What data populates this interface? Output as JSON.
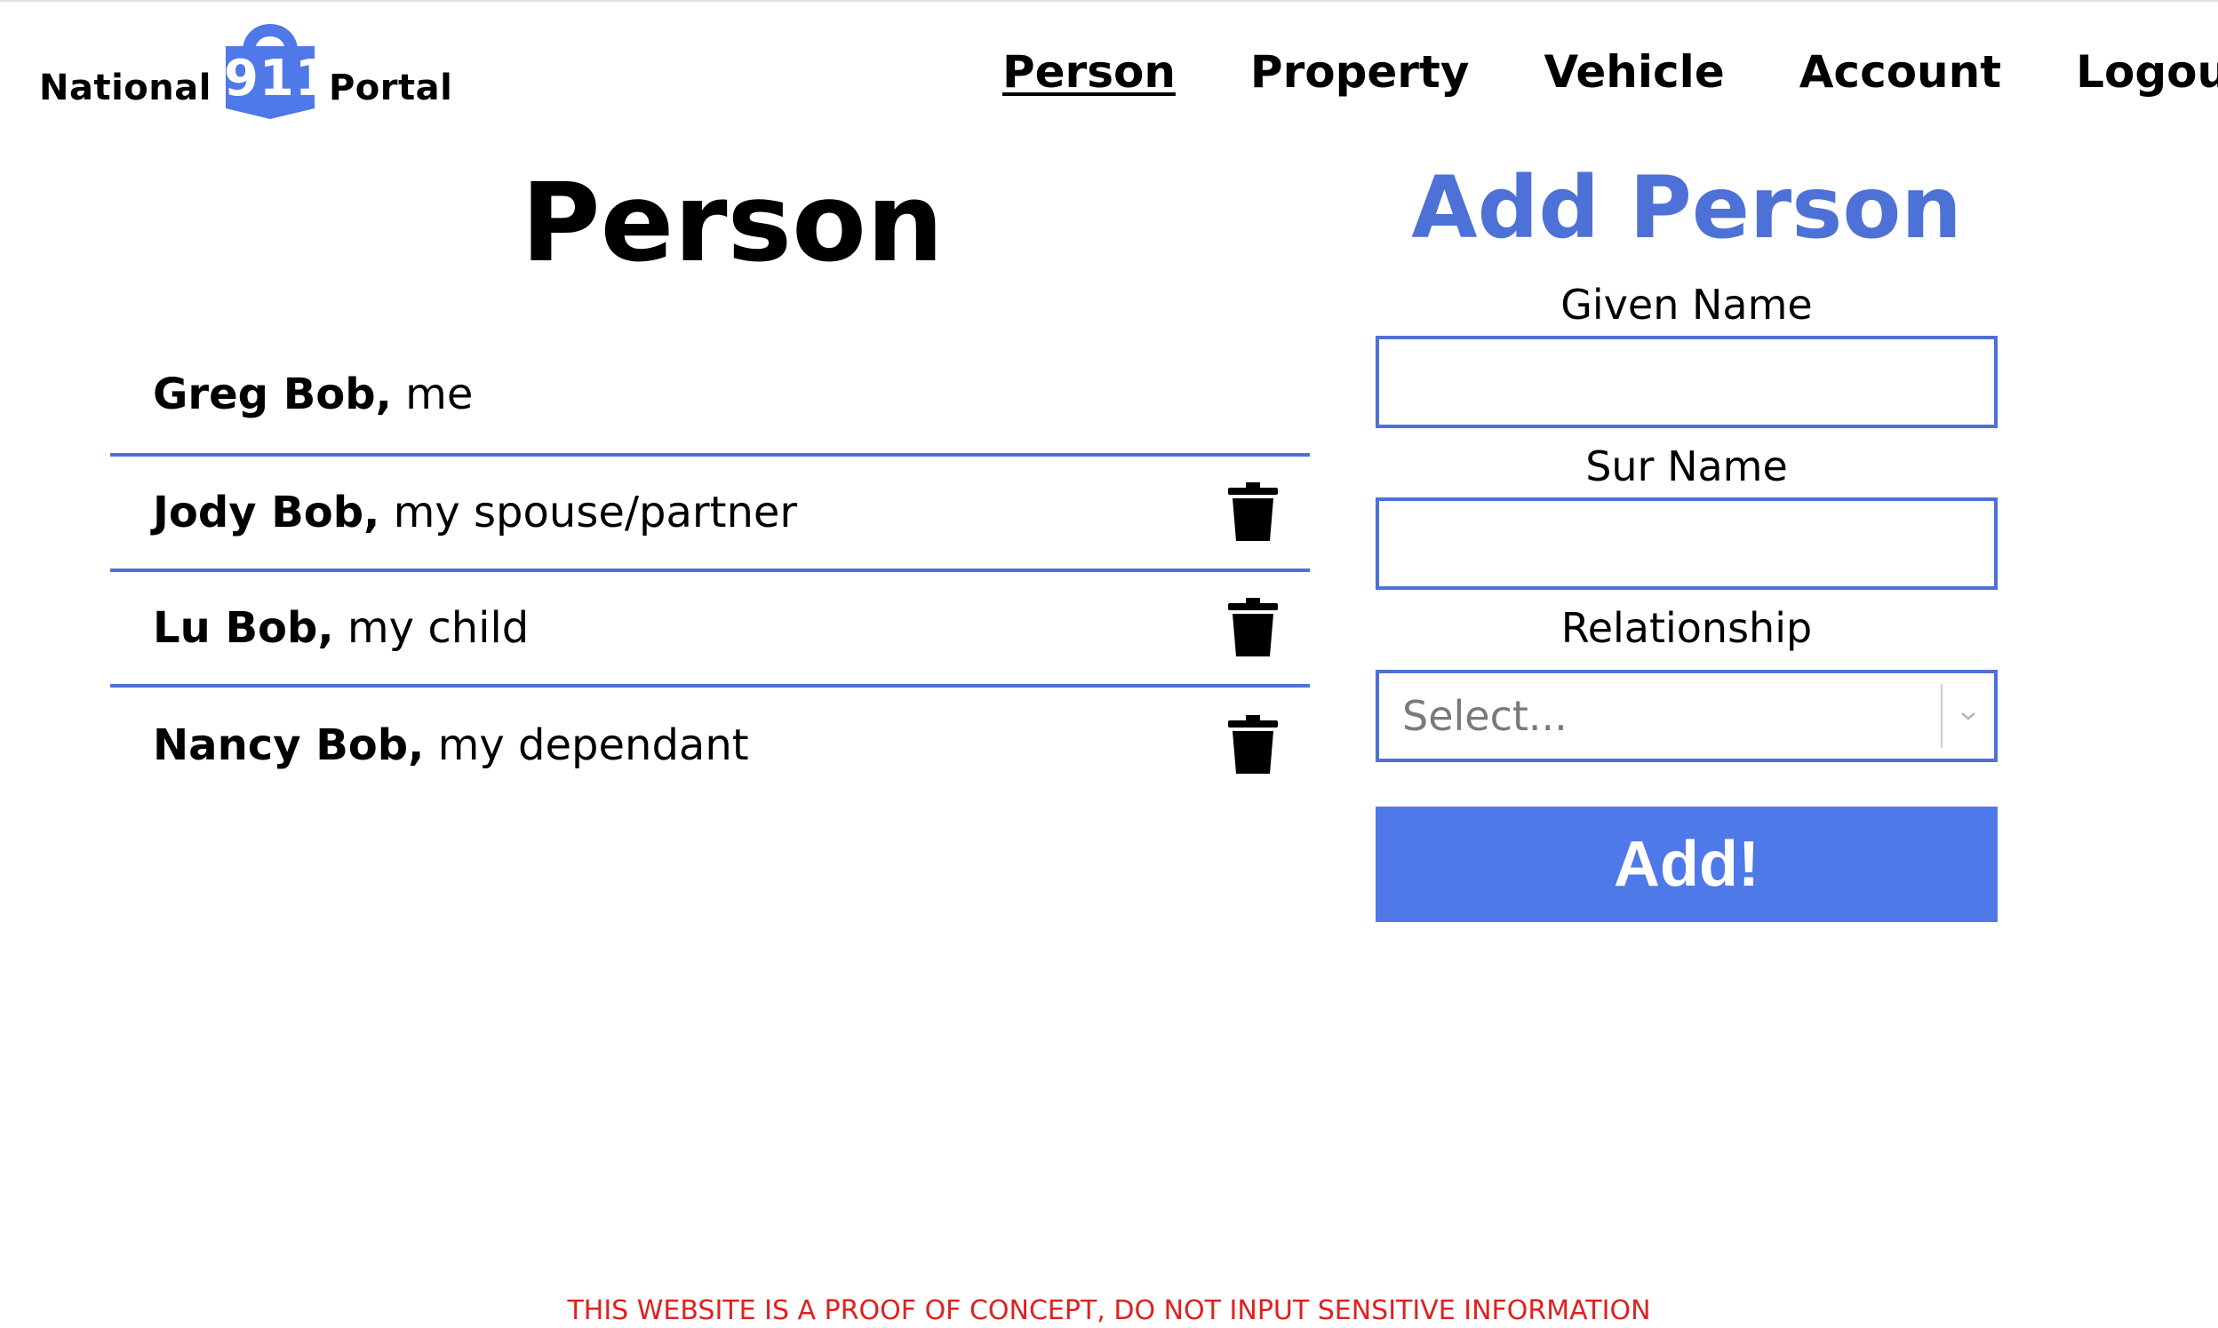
{
  "header": {
    "logo": {
      "word_left": "National",
      "badge_number": "911",
      "word_right": "Portal",
      "badge_color": "#4f78e8"
    },
    "nav": [
      {
        "label": "Person",
        "active": true
      },
      {
        "label": "Property",
        "active": false
      },
      {
        "label": "Vehicle",
        "active": false
      },
      {
        "label": "Account",
        "active": false
      },
      {
        "label": "Logout",
        "active": false
      }
    ]
  },
  "list": {
    "title": "Person",
    "people": [
      {
        "name": "Greg Bob,",
        "relation": "me",
        "deletable": false
      },
      {
        "name": "Jody Bob,",
        "relation": "my spouse/partner",
        "deletable": true
      },
      {
        "name": "Lu Bob,",
        "relation": "my child",
        "deletable": true
      },
      {
        "name": "Nancy Bob,",
        "relation": "my dependant",
        "deletable": true
      }
    ],
    "delete_icon": "trash-icon",
    "divider_color": "#4d71d6"
  },
  "form": {
    "title": "Add Person",
    "given_name": {
      "label": "Given Name",
      "value": "",
      "placeholder": ""
    },
    "sur_name": {
      "label": "Sur Name",
      "value": "",
      "placeholder": ""
    },
    "relationship": {
      "label": "Relationship",
      "selected": "Select..."
    },
    "submit_label": "Add!",
    "accent_color": "#4d71d6"
  },
  "footer": {
    "notice": "THIS WEBSITE IS A PROOF OF CONCEPT, DO NOT INPUT SENSITIVE INFORMATION"
  }
}
